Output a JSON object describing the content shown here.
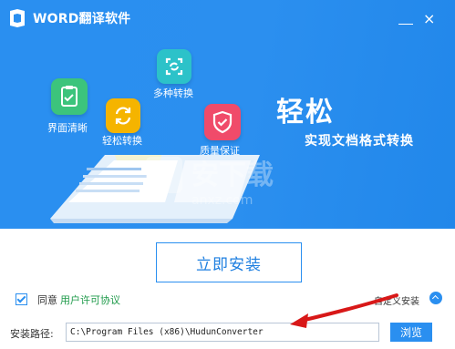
{
  "window": {
    "title": "WORD翻译软件",
    "minimize_icon": "minimize-icon",
    "close_icon": "close-icon",
    "close_glyph": "×"
  },
  "banner": {
    "hero_title": "轻松",
    "hero_subtitle": "实现文档格式转换",
    "features": [
      {
        "label": "界面清晰",
        "icon": "clipboard-check-icon",
        "color": "#3cc47c"
      },
      {
        "label": "轻松转换",
        "icon": "convert-arrows-icon",
        "color": "#f5b400"
      },
      {
        "label": "多种转换",
        "icon": "scan-frame-icon",
        "color": "#2cc2c9"
      },
      {
        "label": "质量保证",
        "icon": "shield-check-icon",
        "color": "#f04b6a"
      }
    ],
    "watermark_text": "安下载",
    "watermark_url": "anxz.com"
  },
  "install": {
    "button_label": "立即安装"
  },
  "agreement": {
    "checked": true,
    "label": "同意",
    "link_label": "用户许可协议"
  },
  "custom_install": {
    "label": "自定义安装"
  },
  "path": {
    "label": "安装路径:",
    "value": "C:\\Program Files (x86)\\HudunConverter",
    "browse_label": "浏览"
  }
}
